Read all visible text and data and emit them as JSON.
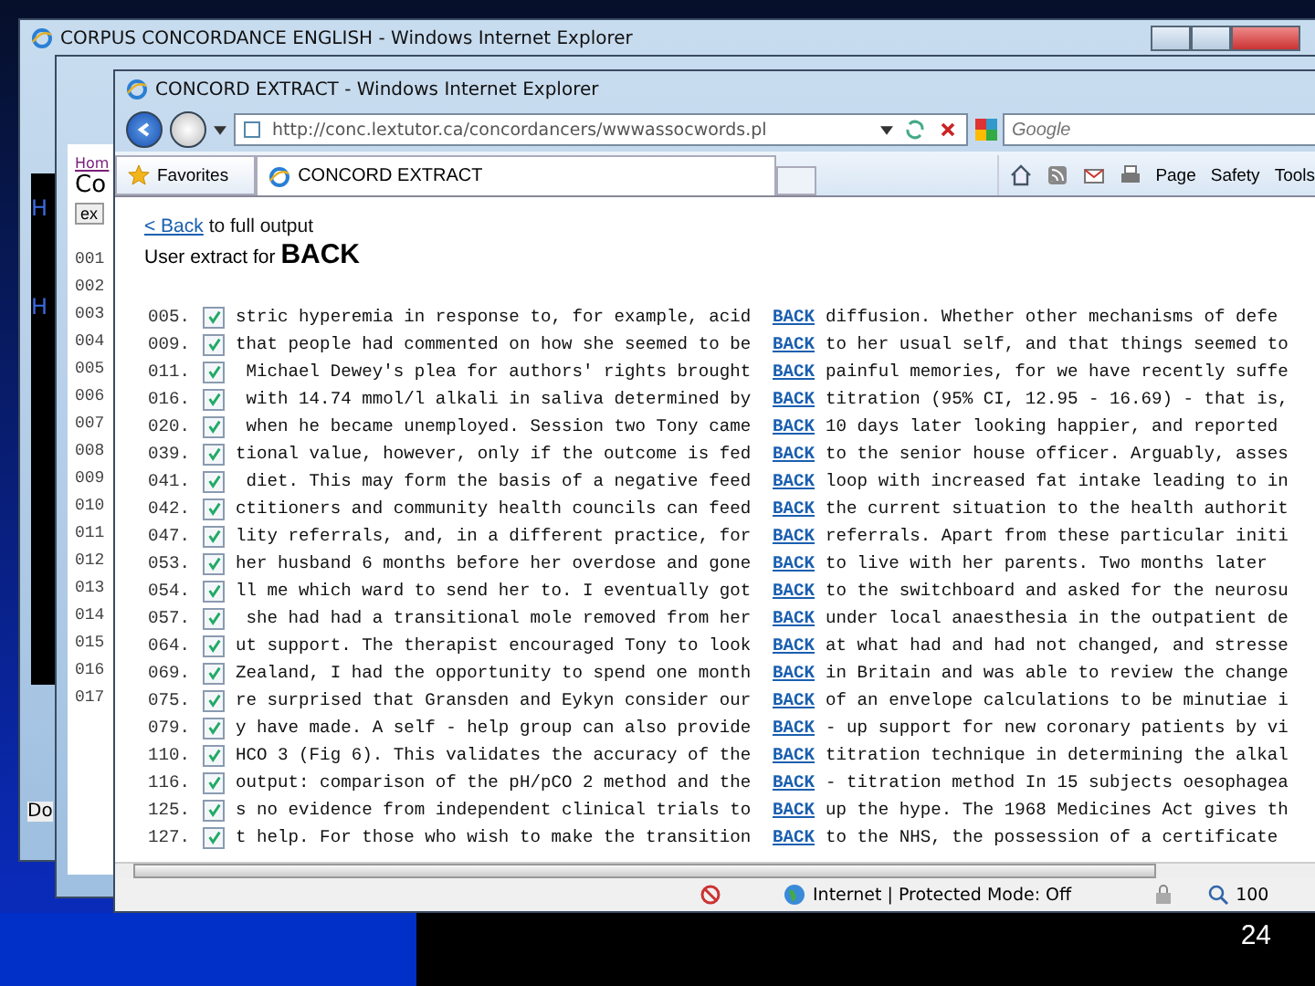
{
  "back_window": {
    "title": "CORPUS CONCORDANCE ENGLISH - Windows Internet Explorer",
    "links": [
      "H",
      "H"
    ],
    "status": "Do"
  },
  "middle_window": {
    "link": "Hom",
    "heading": "Co",
    "button": "ex",
    "line_numbers": [
      "001",
      "002",
      "003",
      "004",
      "005",
      "006",
      "007",
      "008",
      "009",
      "010",
      "011",
      "012",
      "013",
      "014",
      "015",
      "016",
      "017"
    ]
  },
  "window": {
    "title": "CONCORD EXTRACT - Windows Internet Explorer",
    "address": "http://conc.lextutor.ca/concordancers/wwwassocwords.pl",
    "search": {
      "placeholder": "Google"
    },
    "favorites": "Favorites",
    "tab": {
      "label": "CONCORD EXTRACT",
      "selected": true
    },
    "menus": [
      "Page",
      "Safety",
      "Tools"
    ],
    "back_link": "< Back",
    "back_rest": " to full output",
    "extract_label": "User extract for **BACK**",
    "rows": [
      {
        "num": "005.",
        "checked": true,
        "left": "stric hyperemia in response to, for example, acid",
        "keyword": "BACK",
        "right": "diffusion. Whether other mechanisms of defe"
      },
      {
        "num": "009.",
        "checked": true,
        "left": "that people had commented on how she seemed to be",
        "keyword": "BACK",
        "right": "to her usual self, and that things seemed to"
      },
      {
        "num": "011.",
        "checked": true,
        "left": " Michael Dewey's plea for authors' rights brought",
        "keyword": "BACK",
        "right": "painful memories, for we have recently suffe"
      },
      {
        "num": "016.",
        "checked": true,
        "left": " with 14.74 mmol/l alkali in saliva determined by",
        "keyword": "BACK",
        "right": "titration (95% CI, 12.95 - 16.69) - that is,"
      },
      {
        "num": "020.",
        "checked": true,
        "left": " when he became unemployed. Session two Tony came",
        "keyword": "BACK",
        "right": "10 days later looking happier, and reported"
      },
      {
        "num": "039.",
        "checked": true,
        "left": "tional value, however, only if the outcome is fed",
        "keyword": "BACK",
        "right": "to the senior house officer. Arguably, asses"
      },
      {
        "num": "041.",
        "checked": true,
        "left": " diet. This may form the basis of a negative feed",
        "keyword": "BACK",
        "right": "loop with increased fat intake leading to in"
      },
      {
        "num": "042.",
        "checked": true,
        "left": "ctitioners and community health councils can feed",
        "keyword": "BACK",
        "right": "the current situation to the health authorit"
      },
      {
        "num": "047.",
        "checked": true,
        "left": "lity referrals, and, in a different practice, for",
        "keyword": "BACK",
        "right": "referrals. Apart from these particular initi"
      },
      {
        "num": "053.",
        "checked": true,
        "left": "her husband 6 months before her overdose and gone",
        "keyword": "BACK",
        "right": "to live with her parents. Two months later"
      },
      {
        "num": "054.",
        "checked": true,
        "left": "ll me which ward to send her to. I eventually got",
        "keyword": "BACK",
        "right": "to the switchboard and asked for the neurosu"
      },
      {
        "num": "057.",
        "checked": true,
        "left": " she had had a transitional mole removed from her",
        "keyword": "BACK",
        "right": "under local anaesthesia in the outpatient de"
      },
      {
        "num": "064.",
        "checked": true,
        "left": "ut support. The therapist encouraged Tony to look",
        "keyword": "BACK",
        "right": "at what had and had not changed, and stresse"
      },
      {
        "num": "069.",
        "checked": true,
        "left": "Zealand, I had the opportunity to spend one month",
        "keyword": "BACK",
        "right": "in Britain and was able to review the change"
      },
      {
        "num": "075.",
        "checked": true,
        "left": "re surprised that Gransden and Eykyn consider our",
        "keyword": "BACK",
        "right": "of an envelope calculations to be minutiae i"
      },
      {
        "num": "079.",
        "checked": true,
        "left": "y have made. A self - help group can also provide",
        "keyword": "BACK",
        "right": "- up support for new coronary patients by vi"
      },
      {
        "num": "110.",
        "checked": true,
        "left": "HCO 3 (Fig 6). This validates the accuracy of the",
        "keyword": "BACK",
        "right": "titration technique in determining the alkal"
      },
      {
        "num": "116.",
        "checked": true,
        "left": "output: comparison of the pH/pCO 2 method and the",
        "keyword": "BACK",
        "right": "- titration method In 15 subjects oesophagea"
      },
      {
        "num": "125.",
        "checked": true,
        "left": "s no evidence from independent clinical trials to",
        "keyword": "BACK",
        "right": "up the hype. The 1968 Medicines Act gives th"
      },
      {
        "num": "127.",
        "checked": true,
        "left": "t help. For those who wish to make the transition",
        "keyword": "BACK",
        "right": "to the NHS, the possession of a certificate"
      }
    ],
    "status": "Internet | Protected Mode: Off",
    "zoom": "100"
  },
  "slide": {
    "page_number": "24"
  }
}
